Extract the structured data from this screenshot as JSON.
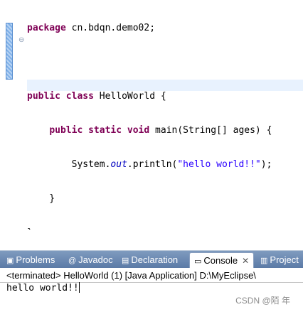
{
  "editor": {
    "lines": [
      {
        "package_kw": "package",
        "package_name": " cn.bdqn.demo02;"
      },
      {},
      {
        "kw1": "public",
        "kw2": "class",
        "name": " HelloWorld {"
      },
      {
        "indent": "    ",
        "kw1": "public",
        "kw2": "static",
        "kw3": "void",
        "sig": " main(String[] ages) {"
      },
      {
        "indent": "        ",
        "pre": "System.",
        "field": "out",
        "mid": ".println(",
        "str": "\"hello world!!\"",
        "post": ");"
      },
      {
        "text": "    }"
      },
      {
        "text": "}"
      }
    ],
    "hscroll_left": "‹"
  },
  "tabs": [
    {
      "icon": "problems-icon",
      "label": "Problems"
    },
    {
      "icon": "javadoc-icon",
      "label": "Javadoc"
    },
    {
      "icon": "declaration-icon",
      "label": "Declaration"
    },
    {
      "icon": "console-icon",
      "label": "Console",
      "close": "✕"
    },
    {
      "icon": "project-icon",
      "label": "Project"
    }
  ],
  "console": {
    "header": "<terminated> HelloWorld (1) [Java Application] D:\\MyEclipse\\",
    "output": "hello world!!"
  },
  "watermark": "CSDN @陌 年",
  "colors": {
    "keyword": "#7f0055",
    "string": "#2a00ff",
    "field": "#0000c0",
    "tabbar": "#6a88b2"
  }
}
